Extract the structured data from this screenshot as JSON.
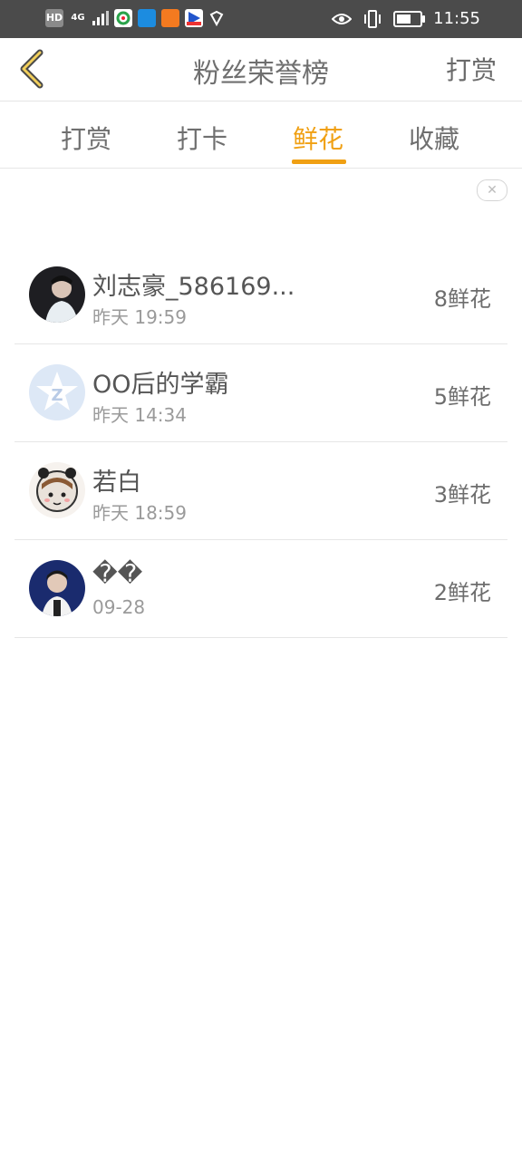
{
  "status_bar": {
    "network_label": "HD",
    "signal_label": "4G",
    "time": "11:55"
  },
  "header": {
    "title": "粉丝荣誉榜",
    "action_label": "打赏"
  },
  "tabs": [
    {
      "label": "打赏"
    },
    {
      "label": "打卡"
    },
    {
      "label": "鲜花",
      "active": true
    },
    {
      "label": "收藏"
    }
  ],
  "fans": [
    {
      "name": "刘志豪_586169...",
      "time": "昨天 19:59",
      "count": "8鲜花"
    },
    {
      "name": "OO后的学霸",
      "time": "昨天 14:34",
      "count": "5鲜花"
    },
    {
      "name": "若白",
      "time": "昨天 18:59",
      "count": "3鲜花"
    },
    {
      "name": "��",
      "time": "09-28",
      "count": "2鲜花"
    }
  ],
  "colors": {
    "accent": "#f0a013",
    "statusbar_bg": "#4b4b4b"
  },
  "icons": [
    "back-arrow-icon",
    "ad-close-icon",
    "eye-icon",
    "vibrate-icon",
    "battery-icon"
  ]
}
